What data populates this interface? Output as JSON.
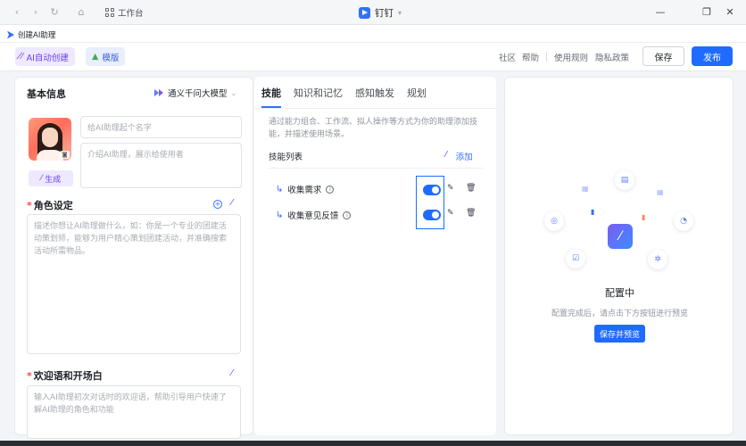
{
  "titlebar": {
    "workbench_label": "工作台",
    "app_title": "钉钉"
  },
  "tab": {
    "label": "创建AI助理"
  },
  "toolbar": {
    "ai_create": "AI自动创建",
    "template": "模版",
    "links": [
      "社区",
      "帮助",
      "使用规则",
      "隐私政策"
    ],
    "save": "保存",
    "publish": "发布"
  },
  "basic": {
    "title": "基本信息",
    "model": "通义千问大模型",
    "name_placeholder": "给AI助理起个名字",
    "intro_placeholder": "介绍AI助理，展示给使用者",
    "generate": "生成",
    "role_title": "角色设定",
    "role_placeholder": "描述你想让AI助理做什么，如：你是一个专业的团建活动策划师，能够为用户精心策划团建活动，并准确搜索活动所需物品。",
    "welcome_title": "欢迎语和开场白",
    "welcome_placeholder": "输入AI助理初次对话时的欢迎语，帮助引导用户快速了解AI助理的角色和功能"
  },
  "skills": {
    "tabs": [
      "技能",
      "知识和记忆",
      "感知触发",
      "规划"
    ],
    "description": "通过能力组合、工作流、拟人操作等方式为你的助理添加技能，并描述使用场景。",
    "list_title": "技能列表",
    "add": "添加",
    "items": [
      {
        "name": "收集需求",
        "enabled": true
      },
      {
        "name": "收集意见反馈",
        "enabled": true
      }
    ]
  },
  "preview": {
    "title": "配置中",
    "subtitle": "配置完成后，请点击下方按钮进行预览",
    "button": "保存并预览"
  },
  "colors": {
    "accent": "#1f6bff",
    "ai_purple": "#6a3df5",
    "required": "#f54a45"
  }
}
